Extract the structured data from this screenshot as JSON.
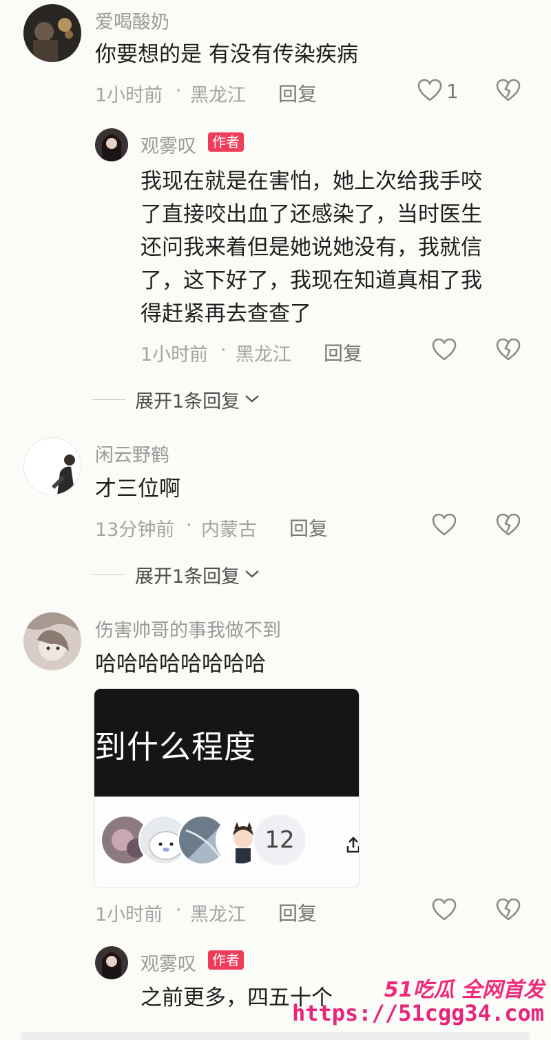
{
  "comments": [
    {
      "username": "爱喝酸奶",
      "text_lines": [
        "你要想的是 有没有传染疾病"
      ],
      "time": "1小时前",
      "location": "黑龙江",
      "reply_label": "回复",
      "like_count": "1"
    },
    {
      "username": "观雾叹",
      "badge": "作者",
      "text_lines": [
        "我现在就是在害怕，她上次给我手咬",
        "了直接咬出血了还感染了，当时医生",
        "还问我来着但是她说她没有，我就信",
        "了，这下好了，我现在知道真相了我",
        "得赶紧再去查查了"
      ],
      "time": "1小时前",
      "location": "黑龙江",
      "reply_label": "回复"
    },
    {
      "username": "闲云野鹤",
      "text_lines": [
        "才三位啊"
      ],
      "time": "13分钟前",
      "location": "内蒙古",
      "reply_label": "回复"
    },
    {
      "username": "伤害帅哥的事我做不到",
      "text_lines": [
        "哈哈哈哈哈哈哈哈"
      ],
      "time": "1小时前",
      "location": "黑龙江",
      "reply_label": "回复",
      "card": {
        "title": "到什么程度",
        "participant_count": "12"
      }
    },
    {
      "username": "观雾叹",
      "badge": "作者",
      "text_lines": [
        "之前更多，四五十个"
      ]
    }
  ],
  "expand_labels": [
    "展开1条回复",
    "展开1条回复"
  ],
  "meta_separator": "·",
  "watermark": {
    "brand": "51吃瓜 全网首发",
    "url": "https://51cgg34.com"
  },
  "colors": {
    "badge": "#f03c5a",
    "watermark": "#e8247a"
  },
  "icons": [
    "heart-icon",
    "broken-heart-icon",
    "chevron-down-icon"
  ]
}
